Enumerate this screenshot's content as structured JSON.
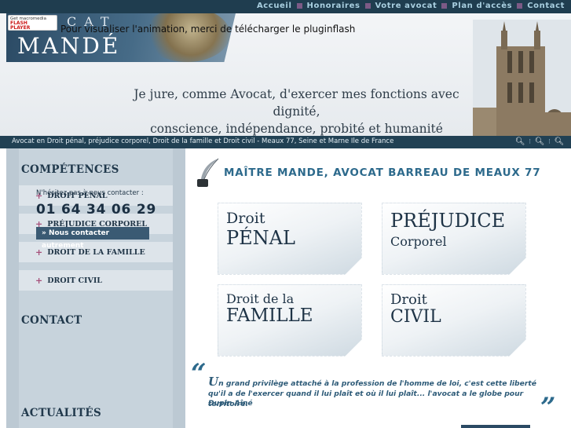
{
  "nav": {
    "items": [
      {
        "label": "Accueil"
      },
      {
        "label": "Honoraires"
      },
      {
        "label": "Votre avocat"
      },
      {
        "label": "Plan d'accès"
      },
      {
        "label": "Contact"
      }
    ]
  },
  "header": {
    "cat": "CAT",
    "mande": "MANDÉ",
    "flash_badge": {
      "line1": "Get macromedia",
      "line2": "FLASH",
      "line3": "PLAYER"
    },
    "flash_note": "Pour visualiser l'animation, merci de télécharger le pluginflash",
    "motto_line1": "Je jure, comme Avocat, d'exercer mes fonctions avec dignité,",
    "motto_line2": "conscience, indépendance, probité et humanité"
  },
  "subbar": {
    "tagline": "Avocat en Droit pénal, préjudice corporel, Droit de la famille et Droit civil - Meaux 77, Seine et Marne Ile de France"
  },
  "sidebar": {
    "competences_title": "COMPÉTENCES",
    "items": [
      {
        "label": "DROIT PÉNAL"
      },
      {
        "label": "PRÉJUDICE CORPOREL"
      },
      {
        "label": "DROIT DE LA FAMILLE"
      },
      {
        "label": "DROIT CIVIL"
      }
    ],
    "contact_title": "CONTACT",
    "contact_note": "N'hésitez pas à nous contacter :",
    "phone": "01 64 34 06 29",
    "contact_button": "» Nous contacter autrement",
    "news_title": "ACTUALITÉS"
  },
  "main": {
    "title": "MAÎTRE MANDE, AVOCAT BARREAU DE MEAUX 77",
    "tiles": [
      {
        "line1": "Droit",
        "line2": "PÉNAL"
      },
      {
        "line1": "PRÉJUDICE",
        "line2": "Corporel"
      },
      {
        "line1": "Droit de la",
        "line2": "FAMILLE"
      },
      {
        "line1": "Droit",
        "line2": "CIVIL"
      }
    ],
    "quote": {
      "open_mark": "“",
      "first_letter": "U",
      "text": "n grand privilège attaché à la profession de l'homme de loi, c'est cette liberté qu'il a de l'exercer quand il lui plaît et où il lui plaît... l'avocat a le globe pour territoire.",
      "author": "Dupin Aîné",
      "close_mark": "”"
    }
  },
  "colors": {
    "nav_bg": "#1f3d4f",
    "nav_link": "#a9cfe0",
    "nav_separator": "#7c5a86",
    "accent_blue": "#2d6a8c",
    "sidebar_bg": "#c7d3dc",
    "plus_bullet": "#a6507a"
  },
  "icons": {
    "zoom": [
      "zoom-out-icon",
      "zoom-reset-icon",
      "zoom-in-icon"
    ],
    "pen": "quill-pen-icon"
  }
}
